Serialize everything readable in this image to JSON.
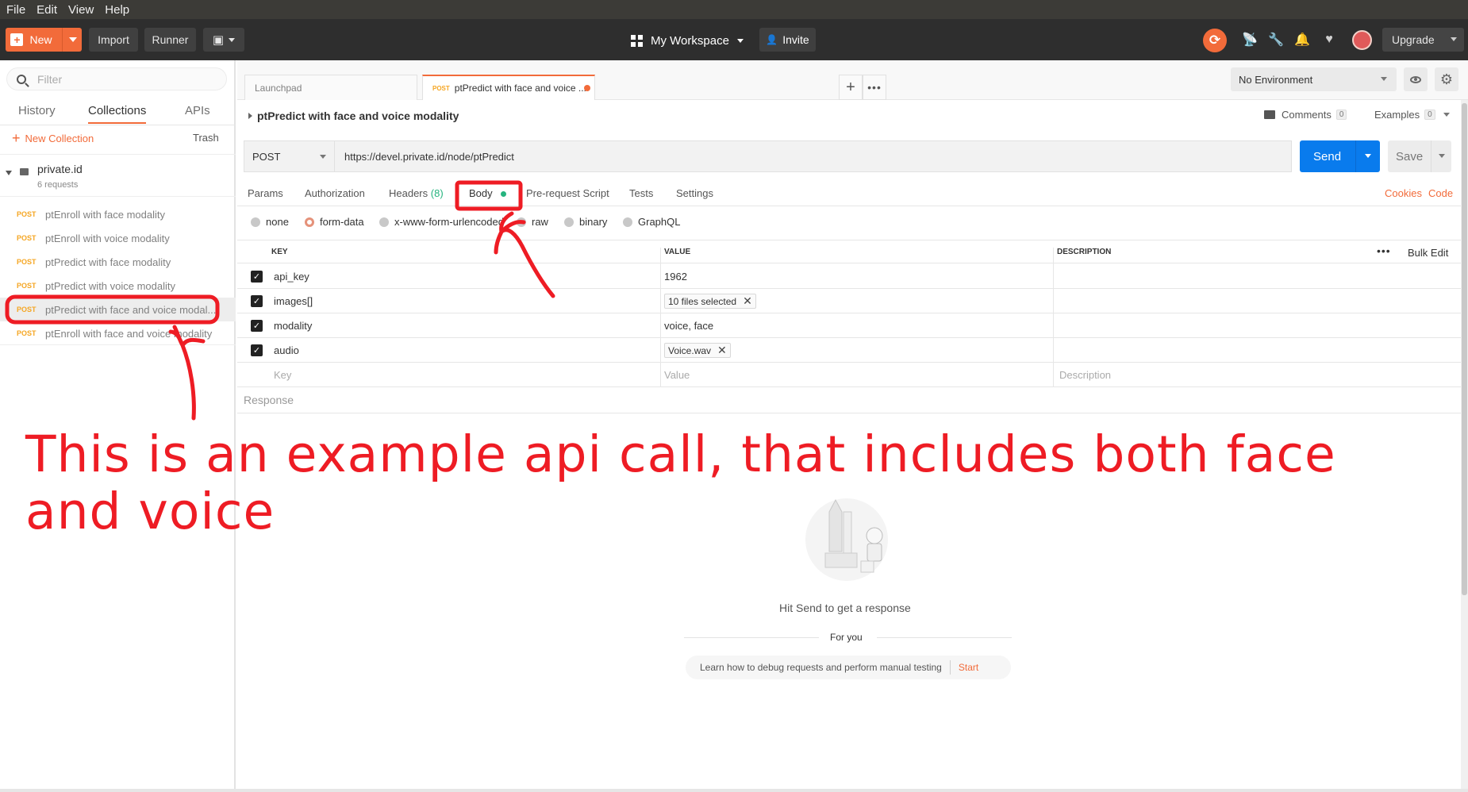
{
  "menu": [
    "File",
    "Edit",
    "View",
    "Help"
  ],
  "header": {
    "new_label": "New",
    "import_label": "Import",
    "runner_label": "Runner",
    "workspace_label": "My Workspace",
    "invite_label": "Invite",
    "upgrade_label": "Upgrade"
  },
  "sidebar": {
    "filter_placeholder": "Filter",
    "tabs": [
      "History",
      "Collections",
      "APIs"
    ],
    "active_tab": "Collections",
    "new_collection": "New Collection",
    "trash": "Trash",
    "collection": {
      "name": "private.id",
      "count": "6 requests"
    },
    "requests": [
      {
        "method": "POST",
        "name": "ptEnroll with face modality"
      },
      {
        "method": "POST",
        "name": "ptEnroll with voice modality"
      },
      {
        "method": "POST",
        "name": "ptPredict with face modality"
      },
      {
        "method": "POST",
        "name": "ptPredict with voice modality"
      },
      {
        "method": "POST",
        "name": "ptPredict with face and voice modal..."
      },
      {
        "method": "POST",
        "name": "ptEnroll with face and voice modality"
      }
    ]
  },
  "tabs": [
    {
      "label": "Launchpad"
    },
    {
      "method": "POST",
      "label": "ptPredict with face and voice ..."
    }
  ],
  "environment": {
    "selected": "No Environment"
  },
  "request": {
    "title": "ptPredict with face and voice modality",
    "comments_label": "Comments",
    "comments_count": "0",
    "examples_label": "Examples",
    "examples_count": "0",
    "method": "POST",
    "url": "https://devel.private.id/node/ptPredict",
    "send_label": "Send",
    "save_label": "Save"
  },
  "subtabs": {
    "params": "Params",
    "authorization": "Authorization",
    "headers": "Headers",
    "headers_count": "(8)",
    "body": "Body",
    "prerequest": "Pre-request Script",
    "tests": "Tests",
    "settings": "Settings",
    "cookies": "Cookies",
    "code": "Code"
  },
  "body_modes": [
    "none",
    "form-data",
    "x-www-form-urlencoded",
    "raw",
    "binary",
    "GraphQL"
  ],
  "body_mode_selected": "form-data",
  "table": {
    "headers": {
      "key": "KEY",
      "value": "VALUE",
      "description": "DESCRIPTION"
    },
    "bulk_edit": "Bulk Edit",
    "rows": [
      {
        "key": "api_key",
        "value": "1962",
        "type": "text"
      },
      {
        "key": "images[]",
        "value": "10 files selected",
        "type": "file"
      },
      {
        "key": "modality",
        "value": "voice, face",
        "type": "text"
      },
      {
        "key": "audio",
        "value": "Voice.wav",
        "type": "file"
      }
    ],
    "placeholders": {
      "key": "Key",
      "value": "Value",
      "description": "Description"
    }
  },
  "response": {
    "label": "Response",
    "empty_message": "Hit Send to get a response",
    "for_you": "For you",
    "learn_text": "Learn how to debug requests and perform manual testing",
    "start_label": "Start"
  },
  "annotation": {
    "text": "This is an example api call, that includes both face and voice",
    "color": "#ee1c24"
  },
  "colors": {
    "accent": "#f26b3a",
    "send": "#097bed",
    "post": "#f5a623",
    "success": "#26b47f"
  }
}
